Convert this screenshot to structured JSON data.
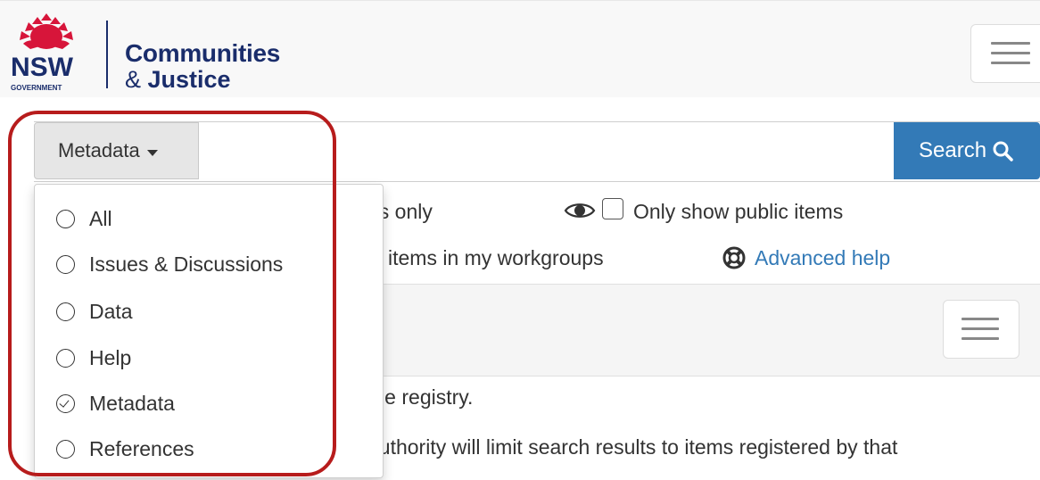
{
  "header": {
    "logo_text": "NSW",
    "logo_subtext": "GOVERNMENT",
    "org_name_line1": "Communities",
    "org_name_line2_prefix": "& ",
    "org_name_line2_bold": "Justice"
  },
  "search": {
    "type_button_label": "Metadata",
    "search_button_label": "Search",
    "input_value": ""
  },
  "options": {
    "items_only_fragment": "es only",
    "public_items_label": "Only show public items",
    "workgroups_fragment": "w items in my workgroups",
    "advanced_help_label": "Advanced help"
  },
  "body_text": {
    "line1_fragment": "the registry.",
    "line2_fragment": "authority will limit search results to items registered by that"
  },
  "dropdown": {
    "items": [
      {
        "label": "All",
        "checked": false
      },
      {
        "label": "Issues & Discussions",
        "checked": false
      },
      {
        "label": "Data",
        "checked": false
      },
      {
        "label": "Help",
        "checked": false
      },
      {
        "label": "Metadata",
        "checked": true
      },
      {
        "label": "References",
        "checked": false
      }
    ]
  },
  "colors": {
    "brand_navy": "#1a2d6b",
    "nsw_red": "#d7153a",
    "primary_blue": "#337ab7",
    "highlight_red": "#b71c1c"
  }
}
